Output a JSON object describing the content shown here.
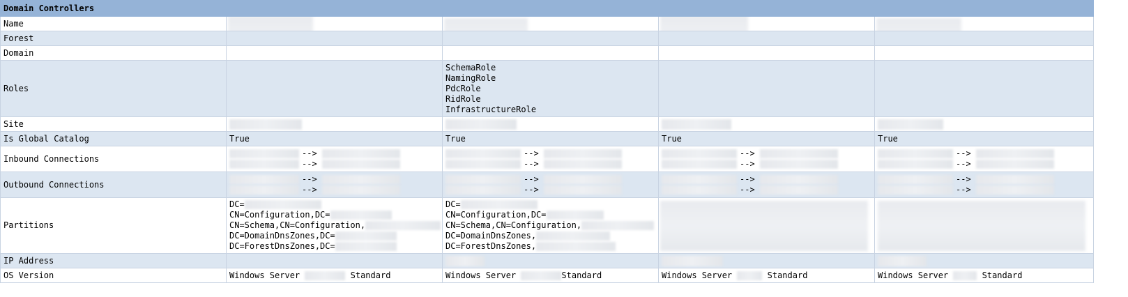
{
  "table": {
    "title": "Domain Controllers",
    "row_labels": {
      "name": "Name",
      "forest": "Forest",
      "domain": "Domain",
      "roles": "Roles",
      "site": "Site",
      "global_catalog": "Is Global Catalog",
      "inbound": "Inbound Connections",
      "outbound": "Outbound Connections",
      "partitions": "Partitions",
      "ip": "IP Address",
      "os": "OS Version"
    },
    "roles_dc2": [
      "SchemaRole",
      "NamingRole",
      "PdcRole",
      "RidRole",
      "InfrastructureRole"
    ],
    "global_catalog_values": [
      "True",
      "True",
      "True",
      "True"
    ],
    "connection_arrow": "-->",
    "partition_prefixes_dc1": [
      "DC=",
      "CN=Configuration,DC=",
      "CN=Schema,CN=Configuration,",
      "DC=DomainDnsZones,DC=",
      "DC=ForestDnsZones,DC="
    ],
    "partition_prefixes_dc2": [
      "DC=",
      "CN=Configuration,DC=",
      "CN=Schema,CN=Configuration,",
      "DC=DomainDnsZones,",
      "DC=ForestDnsZones,"
    ],
    "os_prefix": "Windows Server",
    "os_suffix": "Standard"
  }
}
